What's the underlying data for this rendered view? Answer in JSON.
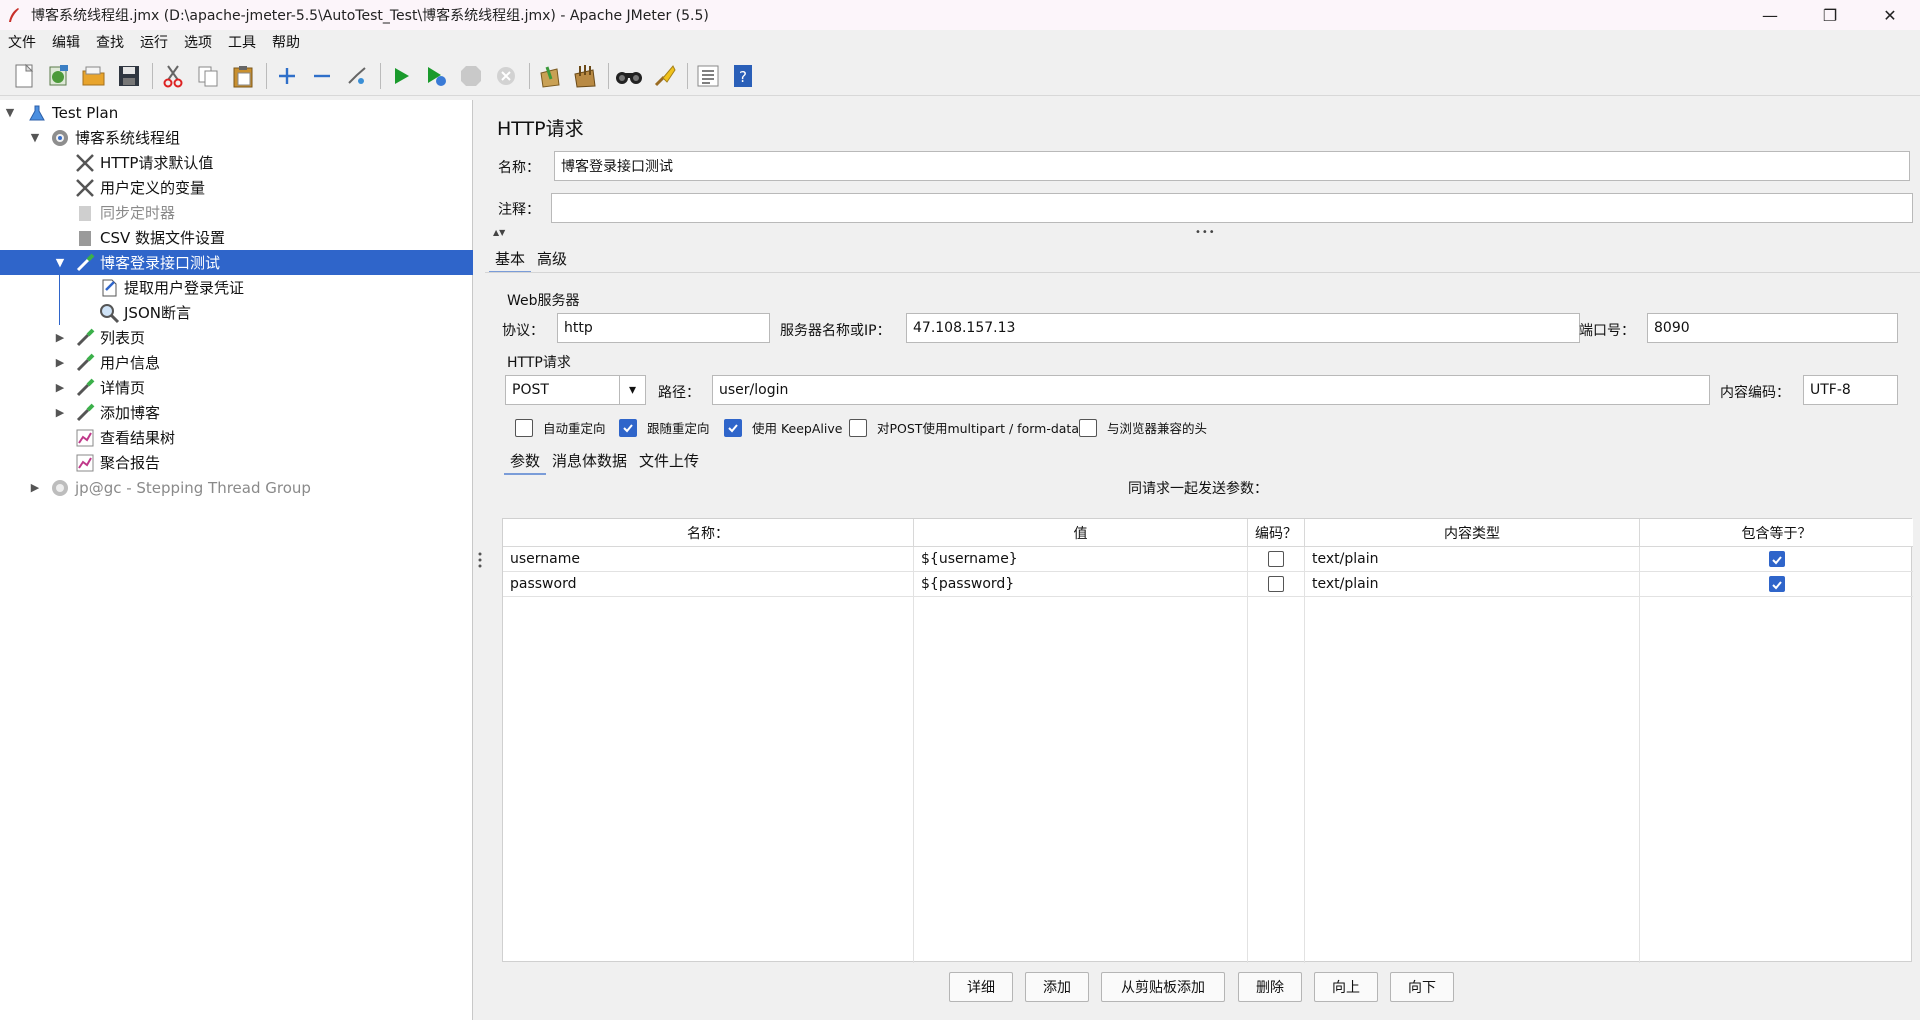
{
  "window": {
    "title": "博客系统线程组.jmx (D:\\apache-jmeter-5.5\\AutoTest_Test\\博客系统线程组.jmx) - Apache JMeter (5.5)",
    "minimize": "—",
    "maximize": "❐",
    "close": "✕"
  },
  "menu": [
    "文件",
    "编辑",
    "查找",
    "运行",
    "选项",
    "工具",
    "帮助"
  ],
  "toolbar": [
    "new-icon",
    "templates-icon",
    "open-icon",
    "save-icon",
    "cut-icon",
    "copy-icon",
    "paste-icon",
    "expand-icon",
    "collapse-icon",
    "toggle-icon",
    "start-icon",
    "start-no-pauses-icon",
    "stop-icon",
    "shutdown-icon",
    "clear-icon",
    "clear-all-icon",
    "search-icon",
    "reset-search-icon",
    "function-helper-icon",
    "help-icon"
  ],
  "tree": {
    "items": [
      {
        "label": "Test Plan"
      },
      {
        "label": "博客系统线程组"
      },
      {
        "label": "HTTP请求默认值"
      },
      {
        "label": "用户定义的变量"
      },
      {
        "label": "同步定时器"
      },
      {
        "label": "CSV 数据文件设置"
      },
      {
        "label": "博客登录接口测试"
      },
      {
        "label": "提取用户登录凭证"
      },
      {
        "label": "JSON断言"
      },
      {
        "label": "列表页"
      },
      {
        "label": "用户信息"
      },
      {
        "label": "详情页"
      },
      {
        "label": "添加博客"
      },
      {
        "label": "查看结果树"
      },
      {
        "label": "聚合报告"
      },
      {
        "label": "jp@gc - Stepping Thread Group"
      }
    ]
  },
  "panel": {
    "title": "HTTP请求",
    "name_label": "名称：",
    "name_value": "博客登录接口测试",
    "comment_label": "注释：",
    "comment_value": "",
    "tabs": [
      "基本",
      "高级"
    ],
    "web_server": {
      "group": "Web服务器",
      "protocol_label": "协议：",
      "protocol": "http",
      "server_label": "服务器名称或IP：",
      "server": "47.108.157.13",
      "port_label": "端口号：",
      "port": "8090"
    },
    "http_request": {
      "group": "HTTP请求",
      "method": "POST",
      "path_label": "路径：",
      "path": "user/login",
      "encoding_label": "内容编码：",
      "encoding": "UTF-8"
    },
    "options": [
      {
        "label": "自动重定向",
        "checked": false
      },
      {
        "label": "跟随重定向",
        "checked": true
      },
      {
        "label": "使用 KeepAlive",
        "checked": true
      },
      {
        "label": "对POST使用multipart / form-data",
        "checked": false
      },
      {
        "label": "与浏览器兼容的头",
        "checked": false
      }
    ],
    "sub_tabs": [
      "参数",
      "消息体数据",
      "文件上传"
    ],
    "params_caption": "同请求一起发送参数：",
    "columns": [
      "名称：",
      "值",
      "编码？",
      "内容类型",
      "包含等于？"
    ],
    "rows": [
      {
        "name": "username",
        "value": "${username}",
        "encode": false,
        "content_type": "text/plain",
        "include_equals": true
      },
      {
        "name": "password",
        "value": "${password}",
        "encode": false,
        "content_type": "text/plain",
        "include_equals": true
      }
    ],
    "buttons": [
      "详细",
      "添加",
      "从剪贴板添加",
      "删除",
      "向上",
      "向下"
    ]
  }
}
